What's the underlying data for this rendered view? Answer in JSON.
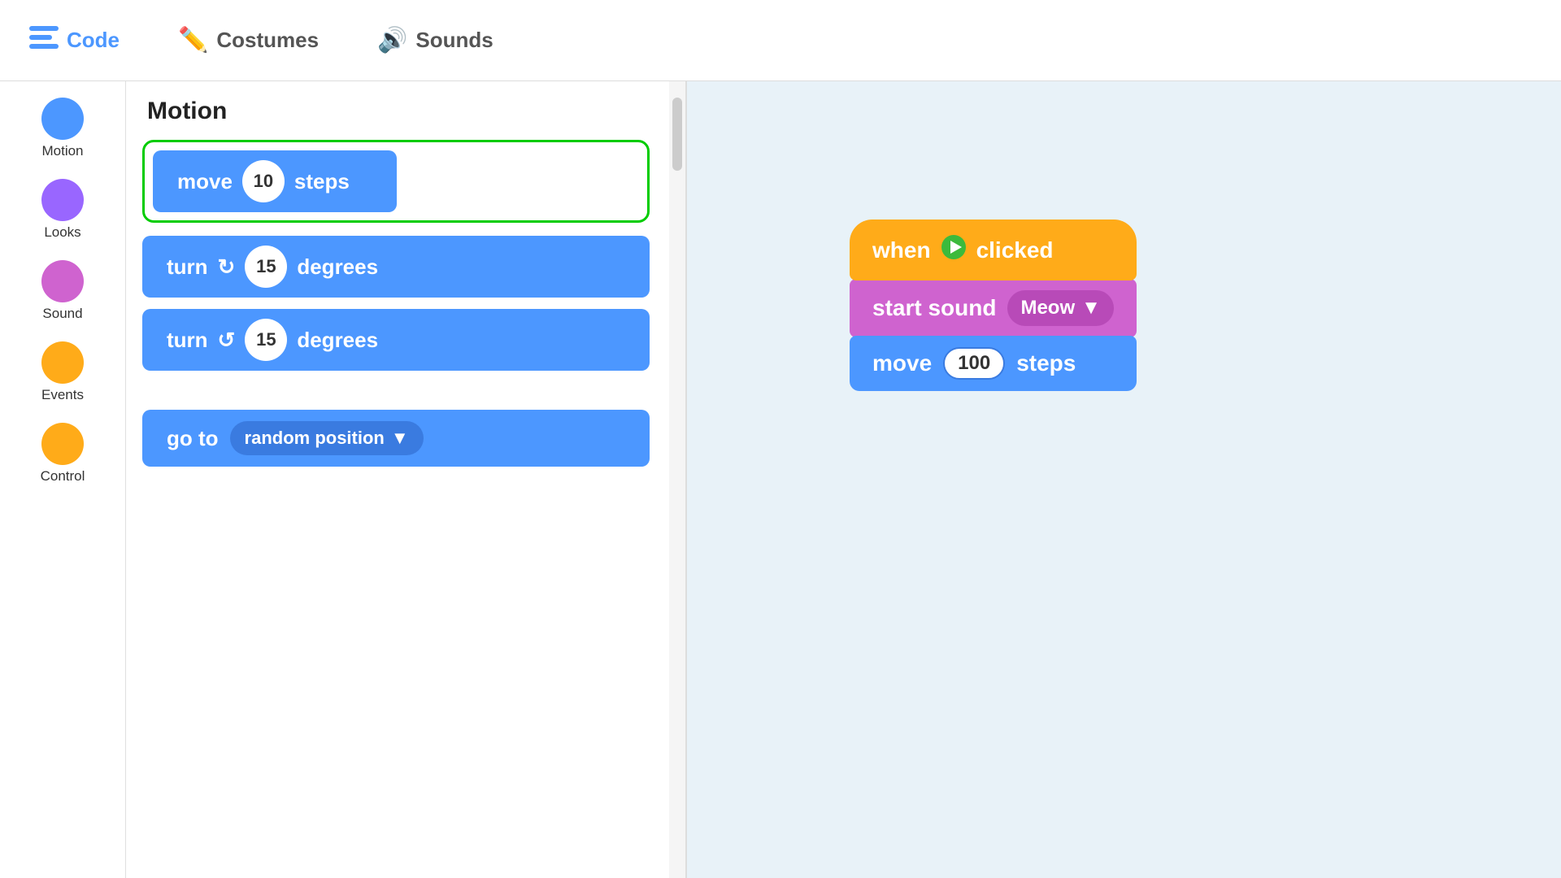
{
  "topbar": {
    "code_label": "Code",
    "costumes_label": "Costumes",
    "sounds_label": "Sounds",
    "code_icon": "≡",
    "costumes_icon": "✏",
    "sounds_icon": "🔊"
  },
  "sidebar": {
    "items": [
      {
        "id": "motion",
        "label": "Motion",
        "color": "#4c97ff"
      },
      {
        "id": "looks",
        "label": "Looks",
        "color": "#9966ff"
      },
      {
        "id": "sound",
        "label": "Sound",
        "color": "#cf63cf"
      },
      {
        "id": "events",
        "label": "Events",
        "color": "#ffab19"
      },
      {
        "id": "control",
        "label": "Control",
        "color": "#ffab19"
      }
    ]
  },
  "block_panel": {
    "title": "Motion",
    "blocks": [
      {
        "id": "move-steps",
        "text_before": "move",
        "value": "10",
        "text_after": "steps",
        "highlighted": true
      },
      {
        "id": "turn-right",
        "text_before": "turn",
        "icon": "↻",
        "value": "15",
        "text_after": "degrees",
        "highlighted": false
      },
      {
        "id": "turn-left",
        "text_before": "turn",
        "icon": "↺",
        "value": "15",
        "text_after": "degrees",
        "highlighted": false
      },
      {
        "id": "goto",
        "text_before": "go to",
        "dropdown": "random position",
        "highlighted": false
      }
    ]
  },
  "canvas": {
    "script": {
      "event_block": "when",
      "event_flag": "🚩",
      "event_suffix": "clicked",
      "sound_label": "start sound",
      "sound_dropdown": "Meow",
      "move_label": "move",
      "move_value": "100",
      "move_suffix": "steps"
    }
  }
}
